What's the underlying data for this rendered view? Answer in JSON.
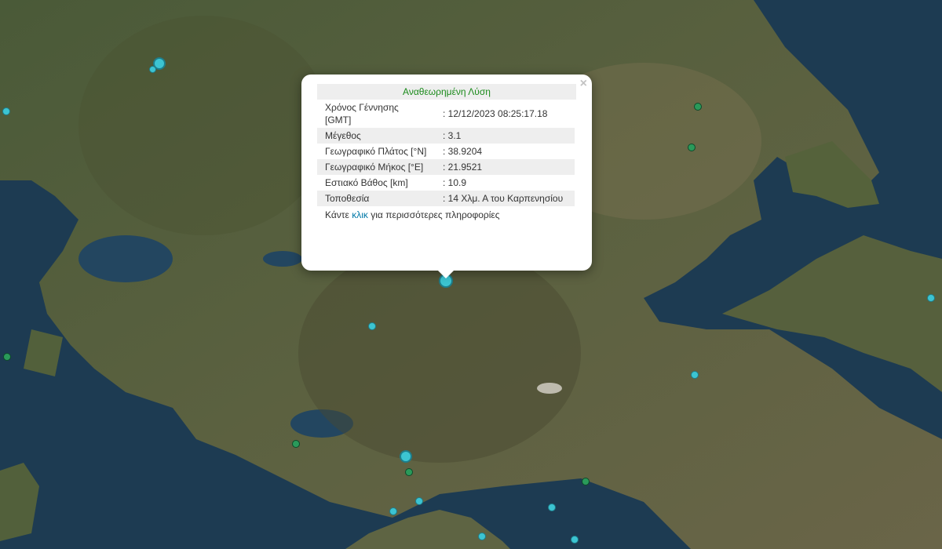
{
  "map": {
    "colors": {
      "water": "#1d3b52",
      "land": "#4f5b3a"
    }
  },
  "popup": {
    "title": "Αναθεωρημένη Λύση",
    "close_icon": "×",
    "rows": [
      {
        "label": "Χρόνος Γέννησης [GMT]",
        "value": ": 12/12/2023 08:25:17.18"
      },
      {
        "label": "Μέγεθος",
        "value": ": 3.1"
      },
      {
        "label": "Γεωγραφικό Πλάτος [°N]",
        "value": ": 38.9204"
      },
      {
        "label": "Γεωγραφικό Μήκος [°E]",
        "value": ": 21.9521"
      },
      {
        "label": "Εστιακό Βάθος [km]",
        "value": ": 10.9"
      },
      {
        "label": "Τοποθεσία",
        "value": ": 14 Χλμ. Α του Καρπενησίου"
      }
    ],
    "footer_prefix": "Κάντε",
    "footer_link": "κλικ",
    "footer_suffix": "για περισσότερες πληροφορίες"
  }
}
